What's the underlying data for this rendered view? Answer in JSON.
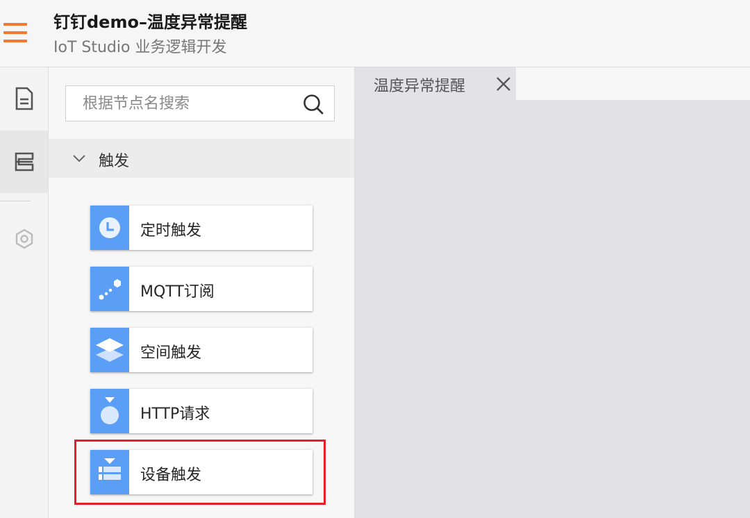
{
  "header": {
    "title": "钉钉demo–温度异常提醒",
    "subtitle": "IoT Studio 业务逻辑开发",
    "menu_icon": "hamburger-menu-icon",
    "accent_color": "#f07a32"
  },
  "rail": {
    "items": [
      {
        "icon": "document-icon",
        "active": false
      },
      {
        "icon": "node-library-icon",
        "active": true
      },
      {
        "icon": "hexagon-settings-icon",
        "active": false
      }
    ]
  },
  "panel": {
    "search": {
      "placeholder": "根据节点名搜索",
      "value": ""
    },
    "group": {
      "label": "触发",
      "expanded": true
    },
    "nodes": [
      {
        "label": "定时触发",
        "icon": "clock-icon"
      },
      {
        "label": "MQTT订阅",
        "icon": "mqtt-icon"
      },
      {
        "label": "空间触发",
        "icon": "layers-icon"
      },
      {
        "label": "HTTP请求",
        "icon": "http-request-icon"
      },
      {
        "label": "设备触发",
        "icon": "device-trigger-icon",
        "highlighted": true
      }
    ],
    "node_color": "#5b9ef5",
    "highlight_color": "#e5202a"
  },
  "workspace": {
    "tabs": [
      {
        "label": "温度异常提醒",
        "close_icon": "close-icon"
      }
    ]
  }
}
